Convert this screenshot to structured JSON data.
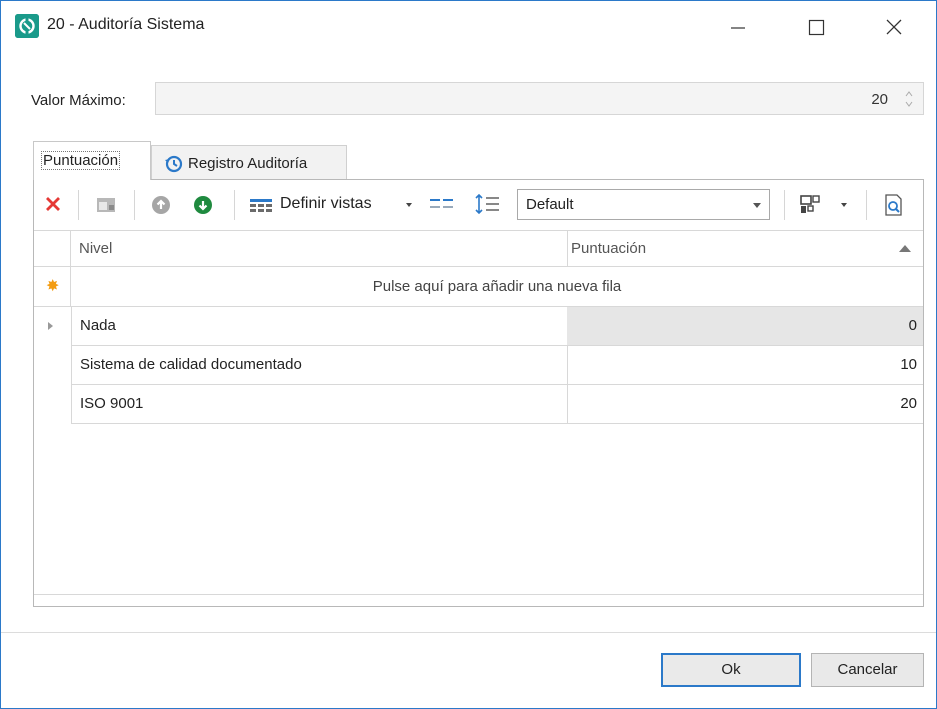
{
  "window": {
    "title": "20 - Auditoría Sistema",
    "accent_color": "#2b79c9",
    "app_icon": "app-logo-icon",
    "controls": [
      "minimize-icon",
      "maximize-icon",
      "close-icon"
    ]
  },
  "form": {
    "valor_label": "Valor Máximo:",
    "valor_value": "20"
  },
  "tabs": [
    {
      "label": "Puntuación",
      "active": true
    },
    {
      "label": "Registro Auditoría",
      "active": false,
      "icon": "history-icon"
    }
  ],
  "toolbar": {
    "delete_icon": "delete-x-icon",
    "define_views_label": "Definir vistas",
    "view_combo_value": "Default"
  },
  "grid": {
    "columns": [
      "Nivel",
      "Puntuación"
    ],
    "new_row_text": "Pulse aquí para añadir una nueva fila",
    "rows": [
      {
        "nivel": "Nada",
        "puntuacion": "0"
      },
      {
        "nivel": "Sistema de calidad documentado",
        "puntuacion": "10"
      },
      {
        "nivel": "ISO 9001",
        "puntuacion": "20"
      }
    ]
  },
  "buttons": {
    "ok": "Ok",
    "cancel": "Cancelar"
  }
}
